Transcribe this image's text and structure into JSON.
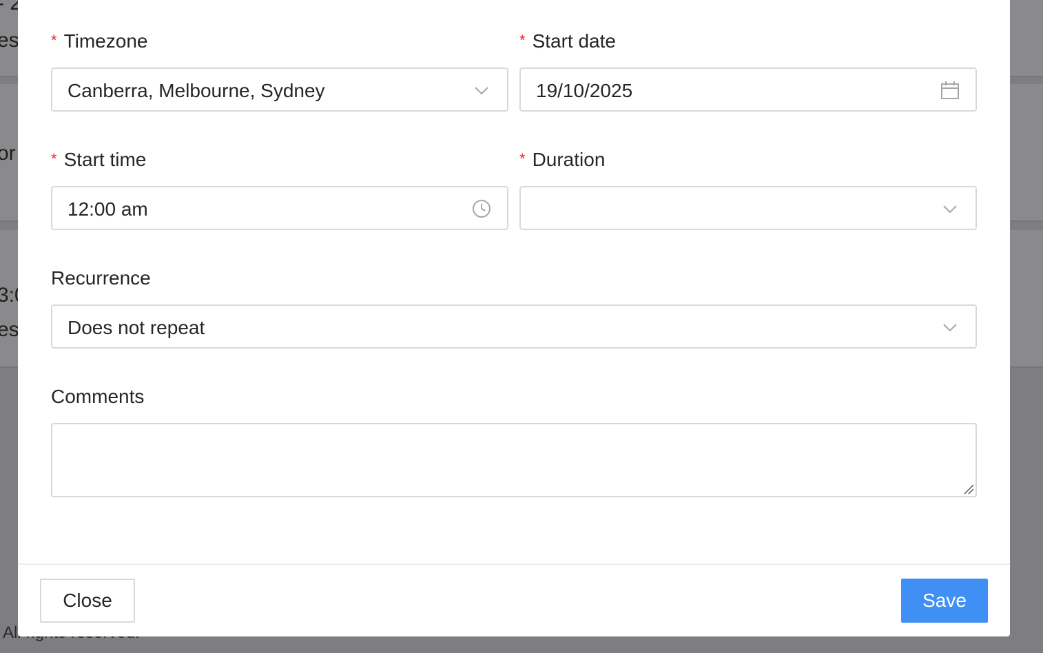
{
  "background": {
    "fragments": [
      "- 2",
      "es",
      "or",
      "3:0",
      "es"
    ],
    "footer_text": "All rights reserved."
  },
  "form": {
    "timezone": {
      "label": "Timezone",
      "required": "*",
      "value": "Canberra, Melbourne, Sydney",
      "icon": "chevron-down-icon"
    },
    "start_date": {
      "label": "Start date",
      "required": "*",
      "value": "19/10/2025",
      "icon": "calendar-icon"
    },
    "start_time": {
      "label": "Start time",
      "required": "*",
      "value": "12:00 am",
      "icon": "clock-icon"
    },
    "duration": {
      "label": "Duration",
      "required": "*",
      "value": "",
      "icon": "chevron-down-icon"
    },
    "recurrence": {
      "label": "Recurrence",
      "value": "Does not repeat",
      "icon": "chevron-down-icon"
    },
    "comments": {
      "label": "Comments",
      "value": ""
    }
  },
  "footer": {
    "close_label": "Close",
    "save_label": "Save"
  },
  "colors": {
    "required": "#f5222d",
    "primary": "#3f8ff5",
    "border": "#d9d9d9",
    "overlay": "#7e7e80"
  }
}
